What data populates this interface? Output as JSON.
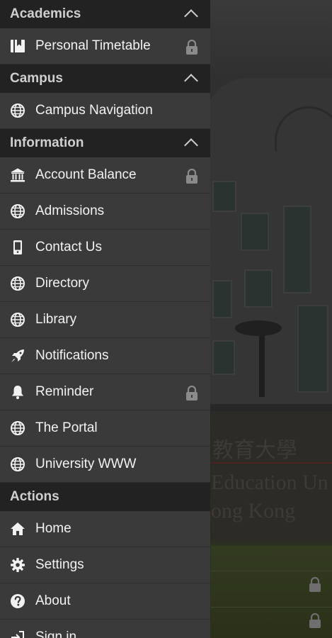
{
  "drawer": {
    "sections": [
      {
        "title": "Academics",
        "collapsible": true,
        "items": [
          {
            "label": "Personal Timetable",
            "icon": "book-icon",
            "locked": true
          }
        ]
      },
      {
        "title": "Campus",
        "collapsible": true,
        "items": [
          {
            "label": "Campus Navigation",
            "icon": "globe-icon",
            "locked": false
          }
        ]
      },
      {
        "title": "Information",
        "collapsible": true,
        "items": [
          {
            "label": "Account Balance",
            "icon": "bank-icon",
            "locked": true
          },
          {
            "label": "Admissions",
            "icon": "globe-icon",
            "locked": false
          },
          {
            "label": "Contact Us",
            "icon": "phone-icon",
            "locked": false
          },
          {
            "label": "Directory",
            "icon": "globe-icon",
            "locked": false
          },
          {
            "label": "Library",
            "icon": "globe-icon",
            "locked": false
          },
          {
            "label": "Notifications",
            "icon": "rocket-icon",
            "locked": false
          },
          {
            "label": "Reminder",
            "icon": "bell-icon",
            "locked": true
          },
          {
            "label": "The Portal",
            "icon": "globe-icon",
            "locked": false
          },
          {
            "label": "University WWW",
            "icon": "globe-icon",
            "locked": false
          }
        ]
      },
      {
        "title": "Actions",
        "collapsible": false,
        "items": [
          {
            "label": "Home",
            "icon": "home-icon",
            "locked": false
          },
          {
            "label": "Settings",
            "icon": "gear-icon",
            "locked": false
          },
          {
            "label": "About",
            "icon": "help-icon",
            "locked": false
          },
          {
            "label": "Sign in",
            "icon": "sign-in-icon",
            "locked": false
          }
        ]
      }
    ]
  },
  "background": {
    "sign_chinese": "教育大學",
    "sign_english_line1": "Education Un",
    "sign_english_line2": "ong Kong"
  },
  "colors": {
    "drawer_bg": "#3a3a3a",
    "section_header_bg": "#222222",
    "text": "#f2f2f2",
    "header_text": "#cfcfcf",
    "lock": "#8a8a8a"
  }
}
